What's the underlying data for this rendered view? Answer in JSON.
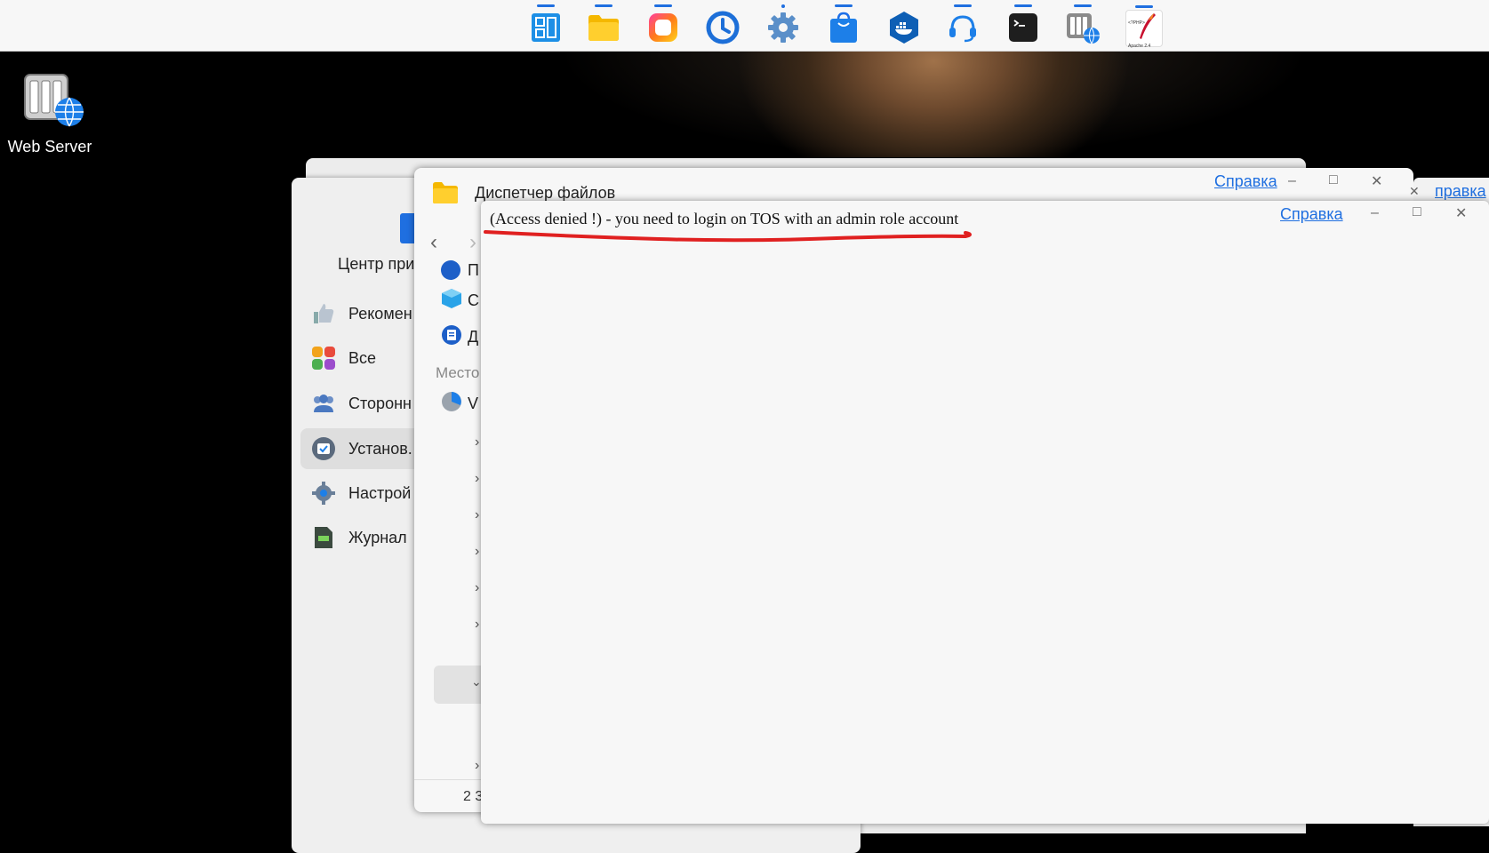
{
  "taskbar": {
    "apps": [
      {
        "name": "app-center-icon",
        "indicator": "dash"
      },
      {
        "name": "file-manager-icon",
        "indicator": "dash"
      },
      {
        "name": "photos-icon",
        "indicator": "dash"
      },
      {
        "name": "backup-clock-icon",
        "indicator": "none"
      },
      {
        "name": "settings-gear-icon",
        "indicator": "dot"
      },
      {
        "name": "app-store-bag-icon",
        "indicator": "dash"
      },
      {
        "name": "docker-icon",
        "indicator": "none"
      },
      {
        "name": "support-headset-icon",
        "indicator": "dash"
      },
      {
        "name": "terminal-icon",
        "indicator": "dash"
      },
      {
        "name": "web-server-icon",
        "indicator": "dash"
      },
      {
        "name": "php-apache-icon",
        "indicator": "dash"
      }
    ],
    "php_apache_text": "<?PHP>\nApache 2.4"
  },
  "desktop": {
    "web_server_label": "Web Server"
  },
  "app_center": {
    "title": "Центр при",
    "sidebar": [
      {
        "label": "Рекомен",
        "icon": "thumbs-up-icon",
        "active": false
      },
      {
        "label": "Все",
        "icon": "grid-apps-icon",
        "active": false
      },
      {
        "label": "Сторонн",
        "icon": "users-group-icon",
        "active": false
      },
      {
        "label": "Установ.",
        "icon": "installed-icon",
        "active": true
      },
      {
        "label": "Настрой",
        "icon": "settings-gear-icon",
        "active": false
      },
      {
        "label": "Журнал",
        "icon": "log-file-icon",
        "active": false
      }
    ]
  },
  "file_manager": {
    "title": "Диспетчер файлов",
    "help": "Справка",
    "rows": [
      {
        "label": "П",
        "icon": "star-icon"
      },
      {
        "label": "С",
        "icon": "cube-icon"
      },
      {
        "label": "Д",
        "icon": "document-icon"
      }
    ],
    "section_label": "Место",
    "volume_label": "V",
    "status": "2 3"
  },
  "message_window": {
    "help": "Справка",
    "message": "(Access denied !) - you need to login on TOS with an admin role account"
  },
  "edge_window": {
    "help": "правка"
  },
  "colors": {
    "accent": "#1f6fe0",
    "annotation_red": "#e02020"
  }
}
